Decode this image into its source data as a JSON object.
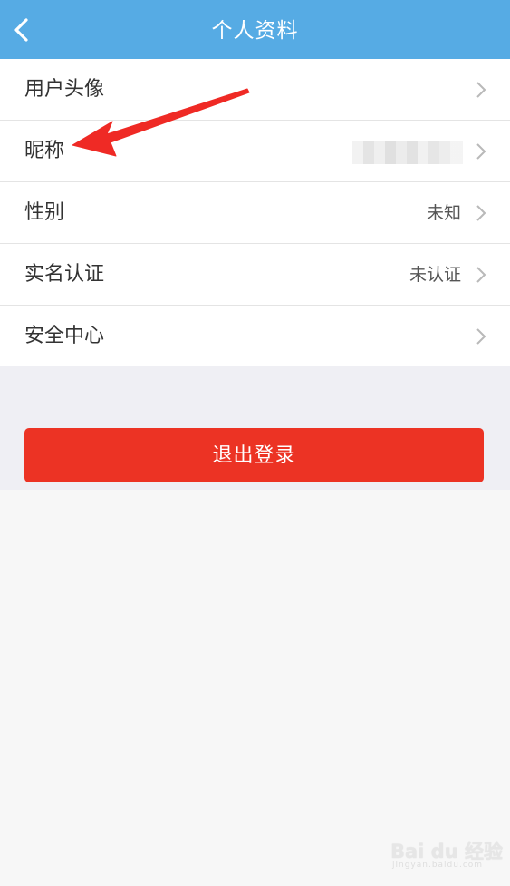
{
  "header": {
    "title": "个人资料",
    "back_icon": "chevron-left-icon",
    "background_color": "#56abe4"
  },
  "profile_items": [
    {
      "id": "avatar",
      "label": "用户头像",
      "value": ""
    },
    {
      "id": "nickname",
      "label": "昵称",
      "value": "",
      "value_obscured": true
    },
    {
      "id": "gender",
      "label": "性别",
      "value": "未知"
    },
    {
      "id": "real-name-verification",
      "label": "实名认证",
      "value": "未认证"
    },
    {
      "id": "security-center",
      "label": "安全中心",
      "value": ""
    }
  ],
  "chevron_icon": "chevron-right-icon",
  "logout": {
    "label": "退出登录",
    "color": "#ec3324"
  },
  "annotation": {
    "arrow_color": "#ef2a25",
    "points_to": "nickname"
  },
  "watermark": {
    "brand": "Bai du 经验",
    "sub": "jingyan.baidu.com"
  }
}
